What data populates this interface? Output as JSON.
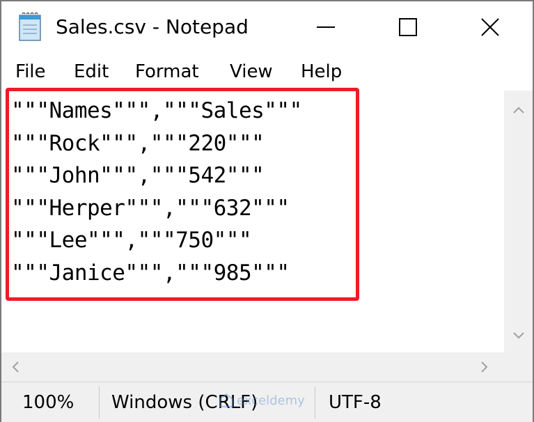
{
  "window": {
    "title": "Sales.csv - Notepad"
  },
  "menu": {
    "items": [
      "File",
      "Edit",
      "Format",
      "View",
      "Help"
    ]
  },
  "editor": {
    "lines": [
      "\"\"\"Names\"\"\",\"\"\"Sales\"\"\"",
      "\"\"\"Rock\"\"\",\"\"\"220\"\"\"",
      "\"\"\"John\"\"\",\"\"\"542\"\"\"",
      "\"\"\"Herper\"\"\",\"\"\"632\"\"\"",
      "\"\"\"Lee\"\"\",\"\"\"750\"\"\"",
      "\"\"\"Janice\"\"\",\"\"\"985\"\"\""
    ],
    "highlight_color": "#ee1c25"
  },
  "status": {
    "zoom": "100%",
    "line_endings": "Windows (CRLF)",
    "encoding": "UTF-8"
  },
  "watermark": {
    "name": "exceldemy"
  },
  "icons": {
    "app": "notepad-icon",
    "minimize": "minimize-icon",
    "maximize": "maximize-icon",
    "close": "close-icon"
  }
}
